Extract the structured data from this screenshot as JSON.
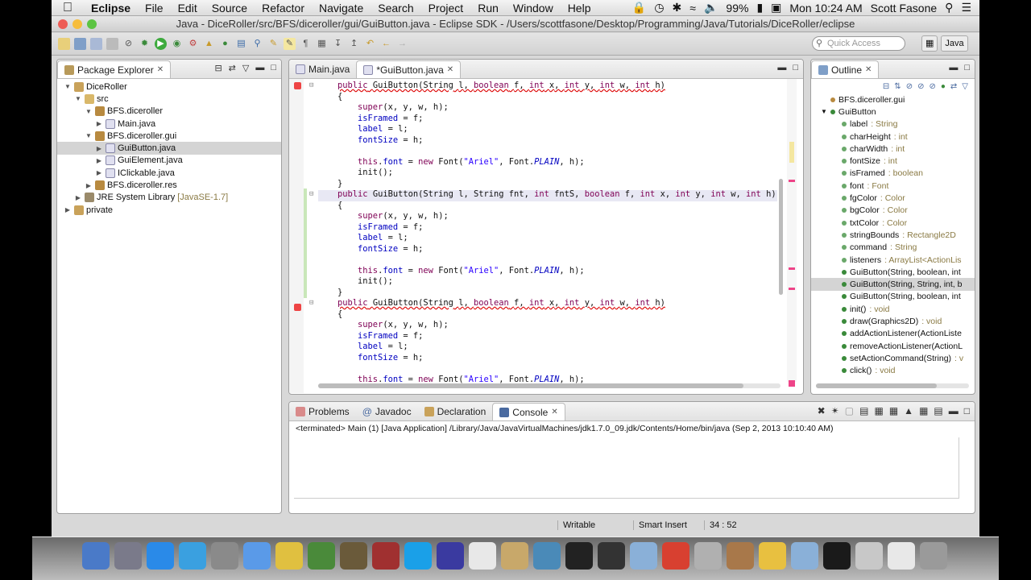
{
  "menubar": {
    "app": "Eclipse",
    "items": [
      "File",
      "Edit",
      "Source",
      "Refactor",
      "Navigate",
      "Search",
      "Project",
      "Run",
      "Window",
      "Help"
    ],
    "battery": "99%",
    "clock": "Mon 10:24 AM",
    "user": "Scott Fasone"
  },
  "window": {
    "title": "Java - DiceRoller/src/BFS/diceroller/gui/GuiButton.java - Eclipse SDK - /Users/scottfasone/Desktop/Programming/Java/Tutorials/DiceRoller/eclipse"
  },
  "toolbar": {
    "quick_access_placeholder": "Quick Access",
    "perspective_label": "Java"
  },
  "package_explorer": {
    "tab_label": "Package Explorer",
    "items": [
      {
        "label": "DiceRoller",
        "extra": ""
      },
      {
        "label": "src",
        "extra": ""
      },
      {
        "label": "BFS.diceroller",
        "extra": ""
      },
      {
        "label": "Main.java",
        "extra": ""
      },
      {
        "label": "BFS.diceroller.gui",
        "extra": ""
      },
      {
        "label": "GuiButton.java",
        "extra": ""
      },
      {
        "label": "GuiElement.java",
        "extra": ""
      },
      {
        "label": "IClickable.java",
        "extra": ""
      },
      {
        "label": "BFS.diceroller.res",
        "extra": ""
      },
      {
        "label": "JRE System Library",
        "extra": "[JavaSE-1.7]"
      },
      {
        "label": "private",
        "extra": ""
      }
    ]
  },
  "editor": {
    "tabs": [
      {
        "label": "Main.java"
      },
      {
        "label": "*GuiButton.java"
      }
    ],
    "lines": [
      "public GuiButton(String l, boolean f, int x, int y, int w, int h)",
      "{",
      "    super(x, y, w, h);",
      "    isFramed = f;",
      "    label = l;",
      "    fontSize = h;",
      "",
      "    this.font = new Font(\"Ariel\", Font.PLAIN, h);",
      "    init();",
      "}",
      "public GuiButton(String l, String fnt, int fntS, boolean f, int x, int y, int w, int h)",
      "{",
      "    super(x, y, w, h);",
      "    isFramed = f;",
      "    label = l;",
      "    fontSize = h;",
      "",
      "    this.font = new Font(\"Ariel\", Font.PLAIN, h);",
      "    init();",
      "}",
      "public GuiButton(String l, boolean f, int x, int y, int w, int h)",
      "{",
      "    super(x, y, w, h);",
      "    isFramed = f;",
      "    label = l;",
      "    fontSize = h;",
      "",
      "    this.font = new Font(\"Ariel\", Font.PLAIN, h);"
    ]
  },
  "outline": {
    "tab_label": "Outline",
    "items": [
      {
        "label": "BFS.diceroller.gui",
        "type": ""
      },
      {
        "label": "GuiButton",
        "type": ""
      },
      {
        "label": "label",
        "type": ": String"
      },
      {
        "label": "charHeight",
        "type": ": int"
      },
      {
        "label": "charWidth",
        "type": ": int"
      },
      {
        "label": "fontSize",
        "type": ": int"
      },
      {
        "label": "isFramed",
        "type": ": boolean"
      },
      {
        "label": "font",
        "type": ": Font"
      },
      {
        "label": "fgColor",
        "type": ": Color"
      },
      {
        "label": "bgColor",
        "type": ": Color"
      },
      {
        "label": "txtColor",
        "type": ": Color"
      },
      {
        "label": "stringBounds",
        "type": ": Rectangle2D"
      },
      {
        "label": "command",
        "type": ": String"
      },
      {
        "label": "listeners",
        "type": ": ArrayList<ActionLis"
      },
      {
        "label": "GuiButton(String, boolean, int",
        "type": ""
      },
      {
        "label": "GuiButton(String, String, int, b",
        "type": ""
      },
      {
        "label": "GuiButton(String, boolean, int",
        "type": ""
      },
      {
        "label": "init()",
        "type": ": void"
      },
      {
        "label": "draw(Graphics2D)",
        "type": ": void"
      },
      {
        "label": "addActionListener(ActionListe",
        "type": ""
      },
      {
        "label": "removeActionListener(ActionL",
        "type": ""
      },
      {
        "label": "setActionCommand(String)",
        "type": ": v"
      },
      {
        "label": "click()",
        "type": ": void"
      }
    ]
  },
  "console": {
    "tabs": [
      "Problems",
      "Javadoc",
      "Declaration",
      "Console"
    ],
    "text": "<terminated> Main (1) [Java Application] /Library/Java/JavaVirtualMachines/jdk1.7.0_09.jdk/Contents/Home/bin/java (Sep 2, 2013 10:10:40 AM)"
  },
  "statusbar": {
    "writable": "Writable",
    "insert_mode": "Smart Insert",
    "position": "34 : 52"
  },
  "dock": {
    "icons": [
      "finder-icon",
      "launchpad-icon",
      "app-store-icon",
      "safari-icon",
      "system-preferences-icon",
      "itunes-icon",
      "chrome-icon",
      "minecraft-icon",
      "toolbox-icon",
      "dictionary-icon",
      "skype-icon",
      "eclipse-icon",
      "textedit-icon",
      "preview-icon",
      "iphoto-icon",
      "terminal-icon",
      "filmstrip-icon",
      "folder-icon",
      "presentation-icon",
      "calculator-icon",
      "archive-icon",
      "cyberduck-icon",
      "folder-2-icon",
      "activity-monitor-icon",
      "printer-icon",
      "screen-icon",
      "trash-icon"
    ]
  },
  "colors": {
    "keyword": "#7f0055",
    "field": "#0000c0",
    "string": "#2a00ff"
  }
}
